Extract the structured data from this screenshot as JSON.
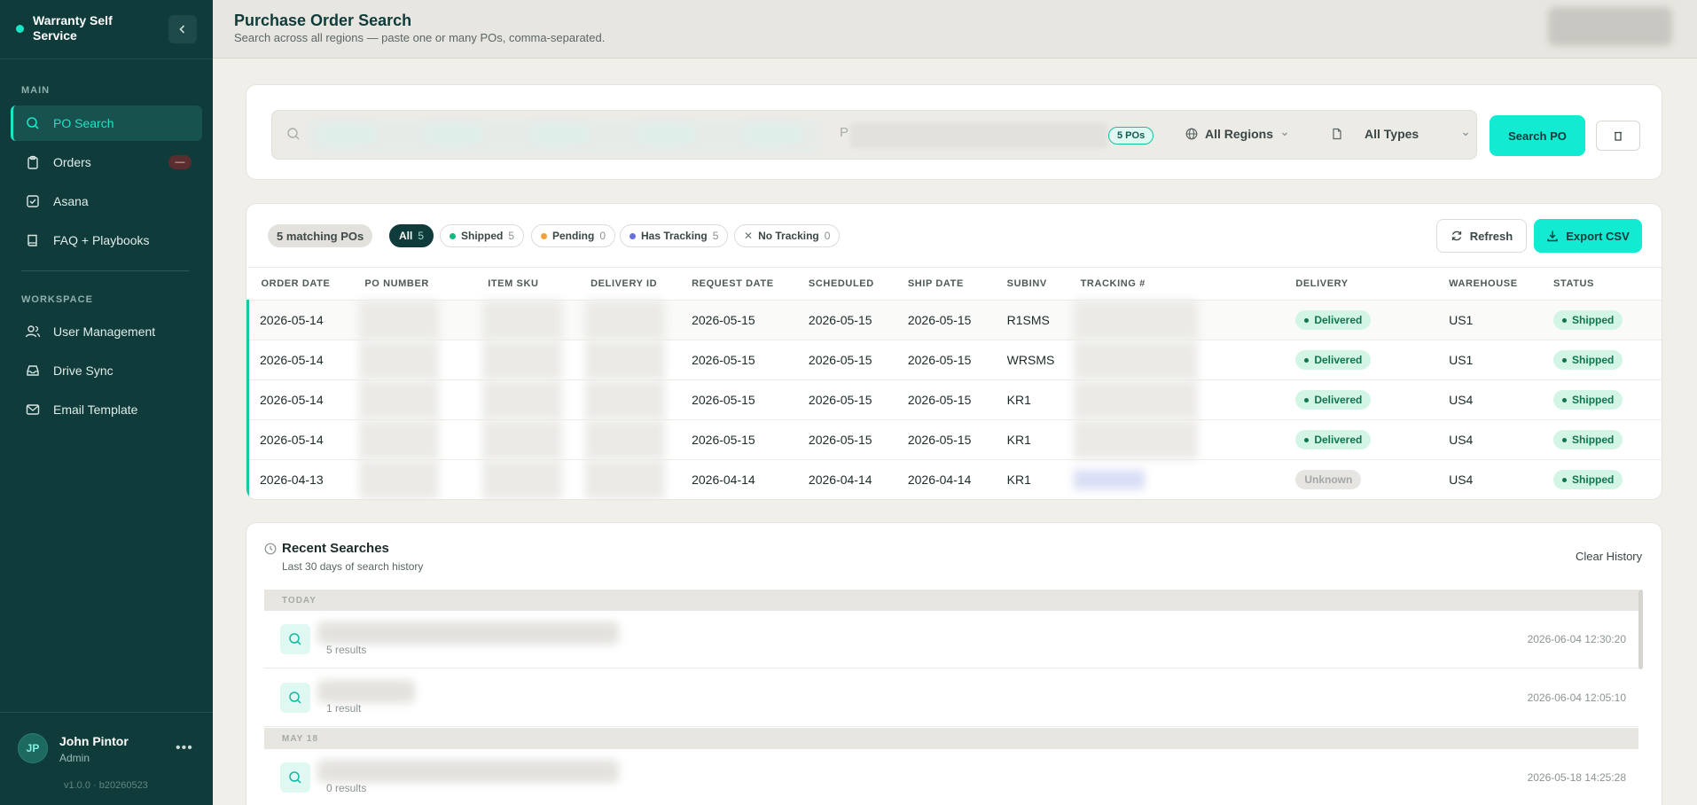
{
  "sidebar": {
    "brand": "Warranty Self Service",
    "sections": {
      "main": "MAIN",
      "workspace": "WORKSPACE"
    },
    "items": [
      {
        "label": "PO Search"
      },
      {
        "label": "Orders",
        "badge": "—"
      },
      {
        "label": "Asana"
      },
      {
        "label": "FAQ + Playbooks"
      },
      {
        "label": "User Management"
      },
      {
        "label": "Drive Sync"
      },
      {
        "label": "Email Template"
      }
    ],
    "user": {
      "initials": "JP",
      "name": "John Pintor",
      "role": "Admin"
    },
    "version": "v1.0.0 · b20260523"
  },
  "header": {
    "title": "Purchase Order Search",
    "subtitle": "Search across all regions — paste one or many POs, comma-separated."
  },
  "search": {
    "placeholder_tail": "P",
    "po_count": "5 POs",
    "region": "All Regions",
    "type": "All Types",
    "search_button": "Search PO"
  },
  "results": {
    "match_label": "5 matching POs",
    "filters": [
      {
        "label": "All",
        "count": "5"
      },
      {
        "label": "Shipped",
        "count": "5"
      },
      {
        "label": "Pending",
        "count": "0"
      },
      {
        "label": "Has Tracking",
        "count": "5"
      },
      {
        "label": "No Tracking",
        "count": "0"
      }
    ],
    "refresh": "Refresh",
    "export": "Export CSV",
    "columns": [
      "ORDER DATE",
      "PO NUMBER",
      "ITEM SKU",
      "DELIVERY ID",
      "REQUEST DATE",
      "SCHEDULED",
      "SHIP DATE",
      "SUBINV",
      "TRACKING #",
      "DELIVERY",
      "WAREHOUSE",
      "STATUS"
    ],
    "rows": [
      {
        "order_date": "2026-05-14",
        "request_date": "2026-05-15",
        "scheduled": "2026-05-15",
        "ship_date": "2026-05-15",
        "subinv": "R1SMS",
        "delivery": "Delivered",
        "warehouse": "US1",
        "status": "Shipped"
      },
      {
        "order_date": "2026-05-14",
        "request_date": "2026-05-15",
        "scheduled": "2026-05-15",
        "ship_date": "2026-05-15",
        "subinv": "WRSMS",
        "delivery": "Delivered",
        "warehouse": "US1",
        "status": "Shipped"
      },
      {
        "order_date": "2026-05-14",
        "request_date": "2026-05-15",
        "scheduled": "2026-05-15",
        "ship_date": "2026-05-15",
        "subinv": "KR1",
        "delivery": "Delivered",
        "warehouse": "US4",
        "status": "Shipped"
      },
      {
        "order_date": "2026-05-14",
        "request_date": "2026-05-15",
        "scheduled": "2026-05-15",
        "ship_date": "2026-05-15",
        "subinv": "KR1",
        "delivery": "Delivered",
        "warehouse": "US4",
        "status": "Shipped"
      },
      {
        "order_date": "2026-04-13",
        "request_date": "2026-04-14",
        "scheduled": "2026-04-14",
        "ship_date": "2026-04-14",
        "subinv": "KR1",
        "delivery": "Unknown",
        "warehouse": "US4",
        "status": "Shipped"
      }
    ]
  },
  "recent": {
    "title": "Recent Searches",
    "subtitle": "Last 30 days of search history",
    "clear": "Clear History",
    "groups": [
      {
        "label": "TODAY",
        "items": [
          {
            "count": "5 results",
            "time": "2026-06-04 12:30:20"
          },
          {
            "count": "1 result",
            "time": "2026-06-04 12:05:10"
          }
        ]
      },
      {
        "label": "MAY 18",
        "items": [
          {
            "count": "0 results",
            "time": "2026-05-18 14:25:28"
          }
        ]
      }
    ]
  },
  "colors": {
    "accent": "#12ead1",
    "sidebar": "#0f3b3a",
    "delivered": "#10744f",
    "pending": "#f0a23a",
    "tracking": "#6a6fe0"
  }
}
